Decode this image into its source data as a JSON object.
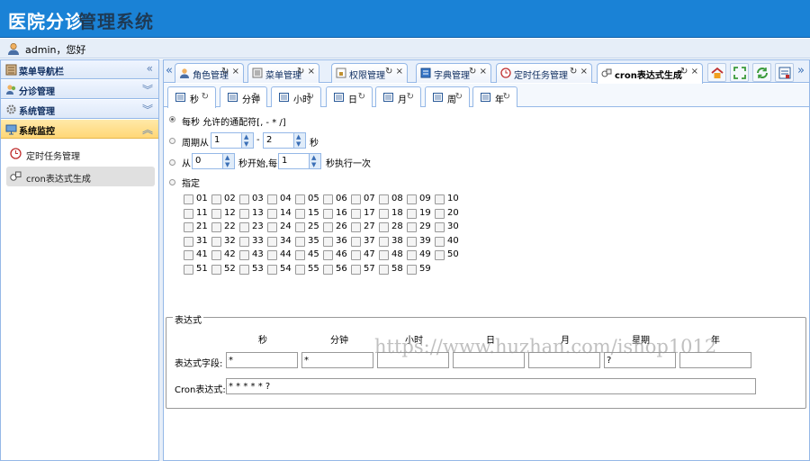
{
  "header": {
    "title_part1": "医院分诊",
    "title_part2": "管理系统"
  },
  "userbar": {
    "text": "admin，您好"
  },
  "sidebar": {
    "nav_title": "菜单导航栏",
    "groups": [
      {
        "label": "分诊管理"
      },
      {
        "label": "系统管理"
      },
      {
        "label": "系统监控"
      }
    ],
    "items": [
      {
        "label": "定时任务管理"
      },
      {
        "label": "cron表达式生成"
      }
    ]
  },
  "tabs": [
    {
      "label": "角色管理"
    },
    {
      "label": "菜单管理"
    },
    {
      "label": "权限管理"
    },
    {
      "label": "字典管理"
    },
    {
      "label": "定时任务管理"
    },
    {
      "label": "cron表达式生成"
    }
  ],
  "icons": {
    "collapse": "«",
    "expand": "»",
    "chev_down": "︾",
    "chev_up": "︽",
    "close": "×",
    "refresh": "↻"
  },
  "subtabs": [
    {
      "label": "秒"
    },
    {
      "label": "分钟"
    },
    {
      "label": "小时"
    },
    {
      "label": "日"
    },
    {
      "label": "月"
    },
    {
      "label": "周"
    },
    {
      "label": "年"
    }
  ],
  "second": {
    "opt_every": "每秒 允许的通配符[, - * /]",
    "opt_period": "周期从",
    "period_from": "1",
    "period_sep": "-",
    "period_to": "2",
    "period_unit": "秒",
    "opt_from": "从",
    "from_start": "0",
    "from_mid": "秒开始,每",
    "from_step": "1",
    "from_end": "秒执行一次",
    "opt_specify": "指定",
    "numbers": [
      "01",
      "02",
      "03",
      "04",
      "05",
      "06",
      "07",
      "08",
      "09",
      "10",
      "11",
      "12",
      "13",
      "14",
      "15",
      "16",
      "17",
      "18",
      "19",
      "20",
      "21",
      "22",
      "23",
      "24",
      "25",
      "26",
      "27",
      "28",
      "29",
      "30",
      "31",
      "32",
      "33",
      "34",
      "35",
      "36",
      "37",
      "38",
      "39",
      "40",
      "41",
      "42",
      "43",
      "44",
      "45",
      "46",
      "47",
      "48",
      "49",
      "50",
      "51",
      "52",
      "53",
      "54",
      "55",
      "56",
      "57",
      "58",
      "59"
    ]
  },
  "expression": {
    "legend": "表达式",
    "headers": [
      "秒",
      "分钟",
      "小时",
      "日",
      "月",
      "星期",
      "年"
    ],
    "field_label": "表达式字段:",
    "field_values": [
      "*",
      "*",
      "",
      "",
      "",
      "?",
      ""
    ],
    "cron_label": "Cron表达式:",
    "cron_value": "* * * * * ?"
  },
  "watermark": "https://www.huzhan.com/ishop1012"
}
